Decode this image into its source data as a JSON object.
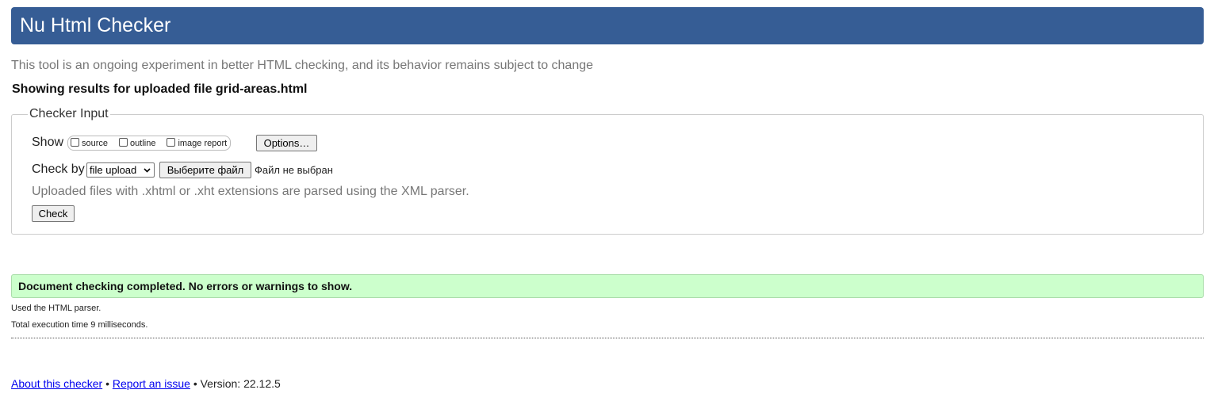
{
  "header": {
    "title": "Nu Html Checker"
  },
  "intro": {
    "text": "This tool is an ongoing experiment in better HTML checking, and its behavior remains subject to change"
  },
  "results_heading": "Showing results for uploaded file grid-areas.html",
  "checker_input": {
    "legend": "Checker Input",
    "show_label": "Show",
    "show_options": [
      {
        "label": "source",
        "checked": false
      },
      {
        "label": "outline",
        "checked": false
      },
      {
        "label": "image report",
        "checked": false
      }
    ],
    "options_button": "Options…",
    "check_by_label": "Check by",
    "check_by_selected": "file upload",
    "file_button": "Выберите файл",
    "file_status": "Файл не выбран",
    "hint": "Uploaded files with .xhtml or .xht extensions are parsed using the XML parser.",
    "check_button": "Check"
  },
  "result": {
    "message": "Document checking completed. No errors or warnings to show.",
    "parser_note": "Used the HTML parser.",
    "execution_time": "Total execution time 9 milliseconds."
  },
  "footer": {
    "about_link": "About this checker",
    "separator": "•",
    "report_link": "Report an issue",
    "version": "Version: 22.12.5"
  },
  "colors": {
    "header_bg": "#365d95",
    "success_bg": "#ccffcc",
    "link": "#0000ee"
  }
}
